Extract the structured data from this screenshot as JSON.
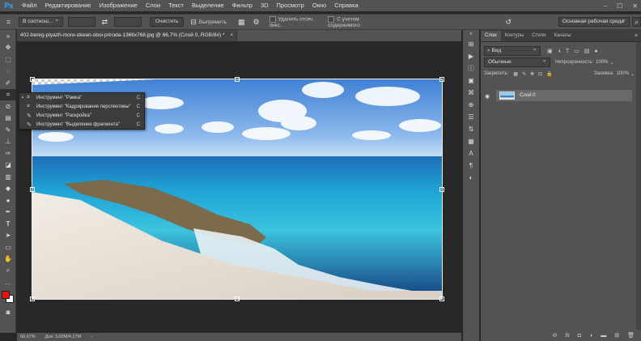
{
  "app": {
    "logo": "Ps"
  },
  "menu": [
    "Файл",
    "Редактирование",
    "Изображение",
    "Слои",
    "Текст",
    "Выделение",
    "Фильтр",
    "3D",
    "Просмотр",
    "Окно",
    "Справка"
  ],
  "window_controls": [
    "–",
    "☐",
    "✕"
  ],
  "options": {
    "ratio_select": "В соотнош...",
    "clear_label": "Очистить",
    "straighten_label": "Выпрямить",
    "delete_cropped_label": "Удалить отсеч. пикс.",
    "content_aware_label": "С учетом содержимого",
    "workspace_select": "Основная рабочая среда"
  },
  "document": {
    "tab_title": "402-bereg-plyazh-more-okean-oboi-priroda-1366x768.jpg @ 66,7% (Слой 0, RGB/8#) *",
    "close": "×"
  },
  "flyout": {
    "items": [
      {
        "label": "Инструмент \"Рамка\"",
        "key": "C",
        "icon": "crop-icon",
        "glyph": "⌗",
        "selected": true
      },
      {
        "label": "Инструмент \"Кадрирование перспективы\"",
        "key": "C",
        "icon": "perspective-crop-icon",
        "glyph": "⌗",
        "selected": false
      },
      {
        "label": "Инструмент \"Раскройка\"",
        "key": "C",
        "icon": "slice-icon",
        "glyph": "✎",
        "selected": false
      },
      {
        "label": "Инструмент \"Выделение фрагмента\"",
        "key": "C",
        "icon": "slice-select-icon",
        "glyph": "✎",
        "selected": false
      }
    ]
  },
  "status": {
    "zoom": "66,67%",
    "doc": "Док: 3,65M/4,17M",
    "arrow": "›"
  },
  "panel": {
    "tabs": [
      "Слои",
      "Контуры",
      "Стили",
      "Каналы"
    ],
    "filter_label": "Вид",
    "blend_mode": "Обычные",
    "opacity_label": "Непрозрачность:",
    "opacity_value": "100%",
    "lock_label": "Закрепить:",
    "fill_label": "Заливка:",
    "fill_value": "100%",
    "layer_name": "Слой 0"
  },
  "colors": {
    "foreground": "#e8120c",
    "background": "#ffffff",
    "ui_bg": "#535353",
    "canvas_bg": "#282828"
  }
}
